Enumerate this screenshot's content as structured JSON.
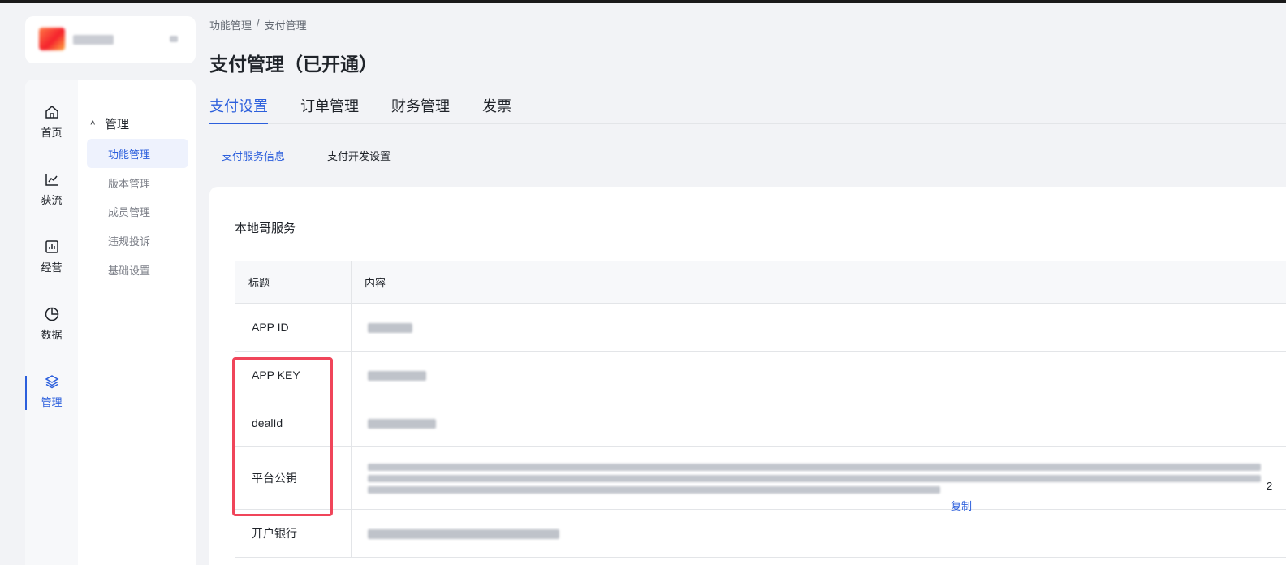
{
  "colors": {
    "accent": "#2c5fdc",
    "highlight": "#f0455a",
    "text": "#1f2329",
    "muted": "#7d8089"
  },
  "rail": [
    {
      "label": "首页",
      "icon": "home-icon",
      "active": false
    },
    {
      "label": "获流",
      "icon": "trend-chart-icon",
      "active": false
    },
    {
      "label": "经营",
      "icon": "bar-chart-icon",
      "active": false
    },
    {
      "label": "数据",
      "icon": "pie-chart-icon",
      "active": false
    },
    {
      "label": "管理",
      "icon": "layers-icon",
      "active": true
    }
  ],
  "menu": {
    "group_label": "管理",
    "items": [
      {
        "label": "功能管理",
        "active": true
      },
      {
        "label": "版本管理",
        "active": false
      },
      {
        "label": "成员管理",
        "active": false
      },
      {
        "label": "违规投诉",
        "active": false
      },
      {
        "label": "基础设置",
        "active": false
      }
    ]
  },
  "breadcrumb": {
    "parent": "功能管理",
    "separator": "/",
    "current": "支付管理"
  },
  "page_title": "支付管理（已开通）",
  "tabs": [
    {
      "label": "支付设置",
      "active": true
    },
    {
      "label": "订单管理",
      "active": false
    },
    {
      "label": "财务管理",
      "active": false
    },
    {
      "label": "发票",
      "active": false
    }
  ],
  "subtabs": [
    {
      "label": "支付服务信息",
      "active": true
    },
    {
      "label": "支付开发设置",
      "active": false
    }
  ],
  "section_title": "本地哥服务",
  "table": {
    "headers": [
      "标题",
      "内容"
    ],
    "rows": [
      {
        "title": "APP ID"
      },
      {
        "title": "APP KEY"
      },
      {
        "title": "dealId"
      },
      {
        "title": "平台公钥",
        "action": "复制",
        "tail": "2"
      },
      {
        "title": "开户银行"
      }
    ]
  }
}
